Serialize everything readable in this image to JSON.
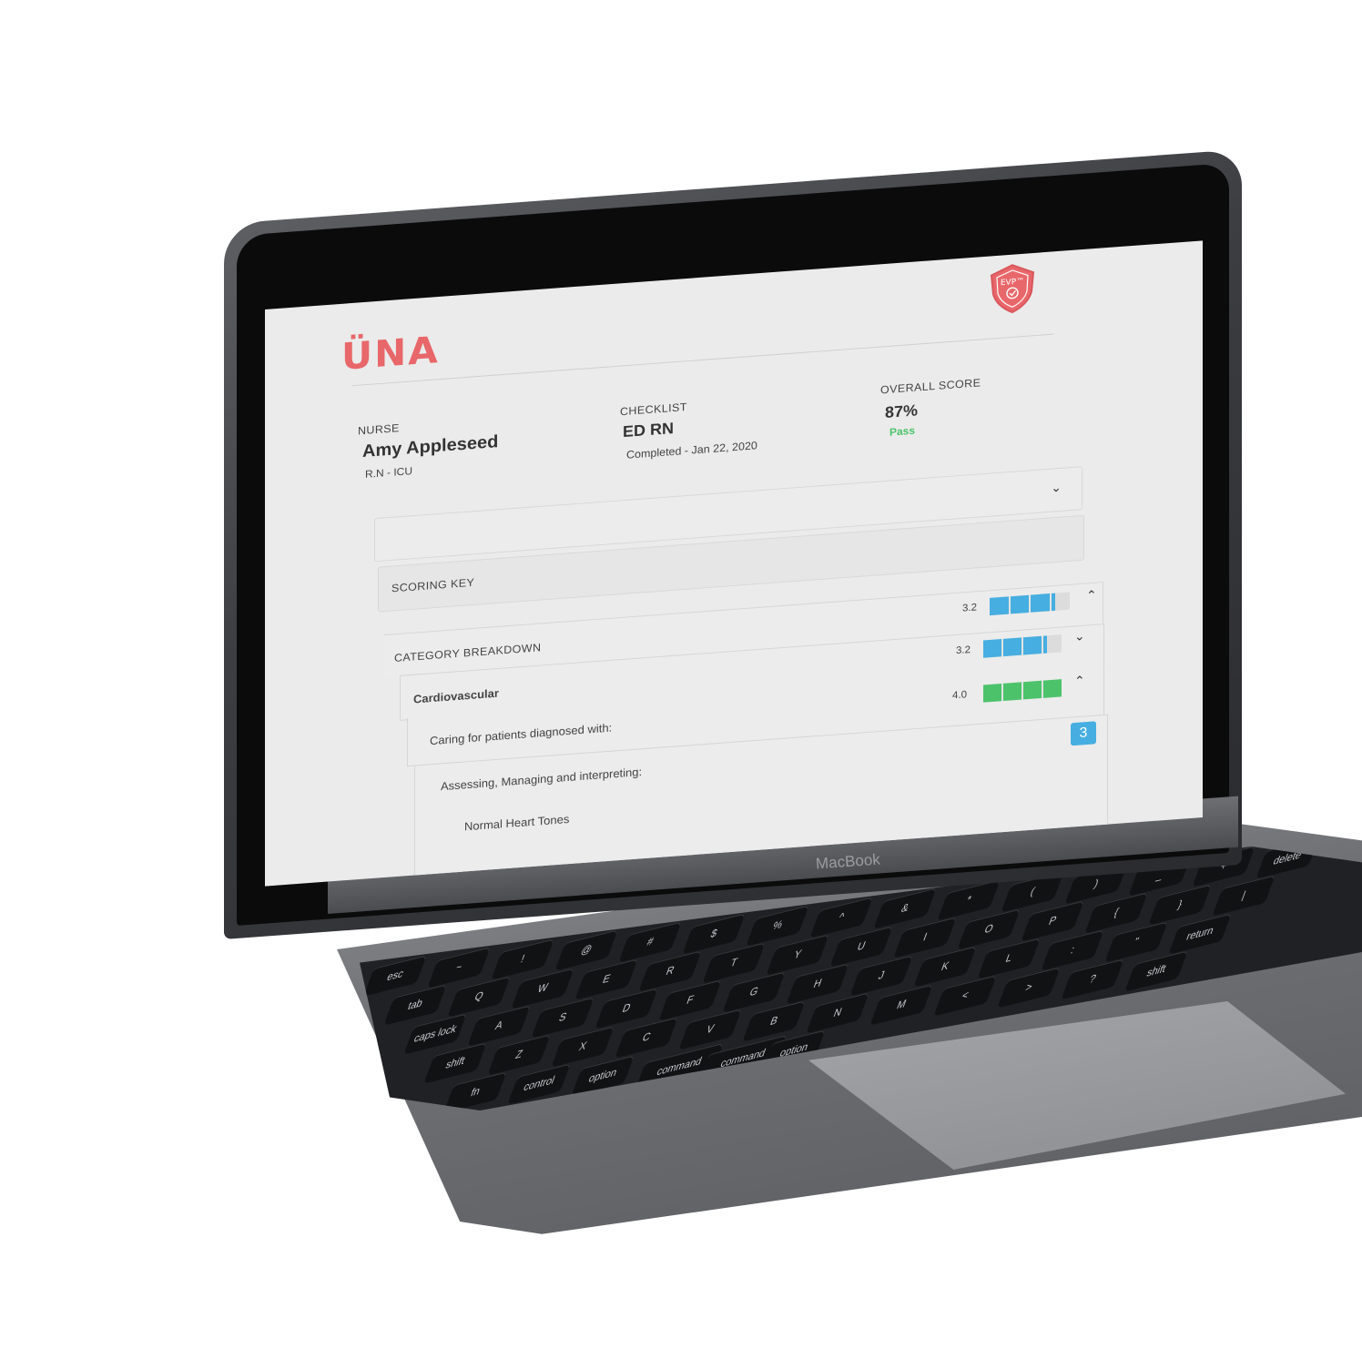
{
  "device": {
    "brand_label": "MacBook"
  },
  "app": {
    "logo_text": "ÜNA",
    "badge_text": "EVP™",
    "nurse": {
      "label": "NURSE",
      "name": "Amy Appleseed",
      "role": "R.N - ICU"
    },
    "checklist": {
      "label": "CHECKLIST",
      "name": "ED RN",
      "status": "Completed - Jan 22, 2020"
    },
    "overall": {
      "label": "OVERALL SCORE",
      "value": "87%",
      "result": "Pass"
    },
    "scoring_key": {
      "label": "SCORING KEY"
    },
    "category": {
      "label": "CATEGORY BREAKDOWN",
      "score": "3.2",
      "fill": 0.8
    },
    "rows": [
      {
        "label": "Cardiovascular",
        "score": "3.2",
        "fill": 0.8,
        "bold": true
      },
      {
        "label": "Caring for patients diagnosed with:",
        "score": "4.0",
        "fill": 1.0
      },
      {
        "label": "Assessing, Managing and interpreting:",
        "badge": "3"
      },
      {
        "label": "Normal Heart Tones"
      }
    ],
    "colors": {
      "accent": "#e8676a",
      "blue_bar": "#46aee0",
      "green_bar": "#4cc36b",
      "pass": "#4cc36b"
    }
  },
  "keyboard": {
    "keys": [
      "esc",
      "~",
      "!",
      "@",
      "#",
      "$",
      "%",
      "^",
      "&",
      "*",
      "(",
      ")",
      "_",
      "+",
      "delete",
      "tab",
      "Q",
      "W",
      "E",
      "R",
      "T",
      "Y",
      "U",
      "I",
      "O",
      "P",
      "{",
      "}",
      "|",
      "caps lock",
      "A",
      "S",
      "D",
      "F",
      "G",
      "H",
      "J",
      "K",
      "L",
      ":",
      "\"",
      "return",
      "shift",
      "Z",
      "X",
      "C",
      "V",
      "B",
      "N",
      "M",
      "<",
      ">",
      "?",
      "shift",
      "fn",
      "control",
      "option",
      "command",
      "command",
      "option"
    ]
  }
}
